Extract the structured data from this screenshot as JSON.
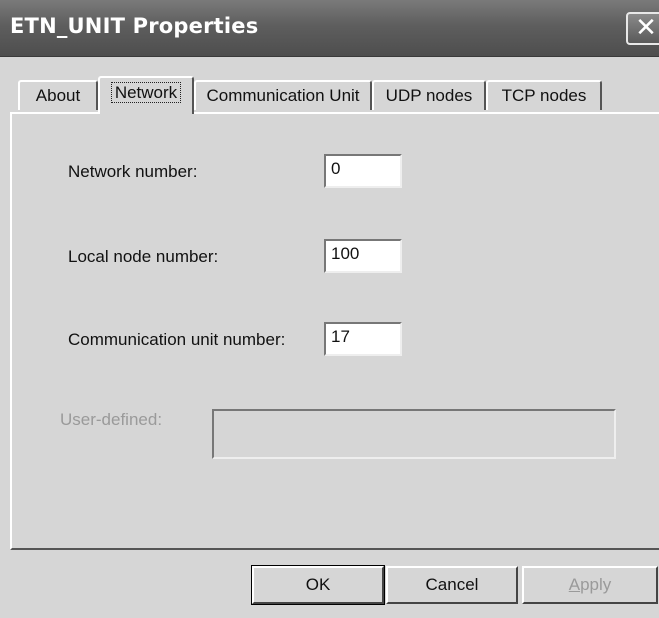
{
  "window": {
    "title": "ETN_UNIT Properties",
    "close_glyph": "✕"
  },
  "tabs": [
    {
      "label": "About"
    },
    {
      "label": "Network",
      "active": true
    },
    {
      "label": "Communication Unit"
    },
    {
      "label": "UDP nodes"
    },
    {
      "label": "TCP nodes"
    }
  ],
  "form": {
    "network_number": {
      "label": "Network number:",
      "value": "0"
    },
    "local_node_number": {
      "label": "Local node number:",
      "value": "100"
    },
    "communication_unit_number": {
      "label": "Communication unit number:",
      "value": "17"
    },
    "user_defined": {
      "label": "User-defined:",
      "value": "",
      "disabled": true
    }
  },
  "buttons": {
    "ok": "OK",
    "cancel": "Cancel",
    "apply_first": "A",
    "apply_rest": "pply"
  },
  "colors": {
    "titlebar": "#5e5e5e",
    "face": "#d6d6d6",
    "disabled_text": "#9a9a9a"
  }
}
